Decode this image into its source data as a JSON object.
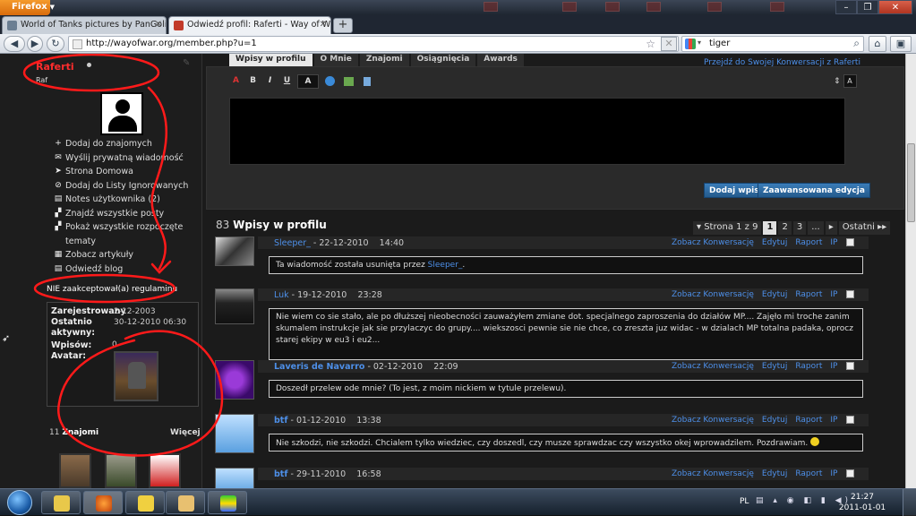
{
  "browser": {
    "menu_label": "Firefox",
    "tabs": [
      {
        "title": "World of Tanks pictures by PanGolia..."
      },
      {
        "title": "Odwiedź profil: Raferti - Way of War"
      }
    ],
    "new_tab": "+",
    "url": "http://wayofwar.org/member.php?u=1",
    "search_value": "tiger",
    "window_controls": {
      "minimize": "–",
      "maximize": "❐",
      "close": "✕"
    }
  },
  "profile": {
    "username": "Raferti",
    "user_title": "Raf",
    "actions": [
      {
        "icon": "plus-icon",
        "glyph": "+",
        "label": "Dodaj do znajomych"
      },
      {
        "icon": "mail-icon",
        "glyph": "✉",
        "label": "Wyślij prywatną wiadomość"
      },
      {
        "icon": "cursor-icon",
        "glyph": "➤",
        "label": "Strona Domowa"
      },
      {
        "icon": "block-icon",
        "glyph": "⊘",
        "label": "Dodaj do Listy Ignorowanych"
      },
      {
        "icon": "notes-icon",
        "glyph": "▤",
        "label": "Notes użytkownika (2)"
      },
      {
        "icon": "posts-icon",
        "glyph": "▞",
        "label": "Znajdź wszystkie posty"
      },
      {
        "icon": "threads-icon",
        "glyph": "▞",
        "label": "Pokaż wszystkie rozpoczęte tematy"
      },
      {
        "icon": "articles-icon",
        "glyph": "▦",
        "label": "Zobacz artykuły"
      },
      {
        "icon": "blog-icon",
        "glyph": "▤",
        "label": "Odwiedź blog"
      }
    ],
    "rules_status": "NIE zaakceptował(a) regulaminu",
    "info": {
      "joined_label": "Zarejestrowany",
      "joined_value": "2-12-2003",
      "last_active_label_1": "Ostatnio",
      "last_active_label_2": "aktywny:",
      "last_active_value": "30-12-2010 06:30",
      "posts_label": "Wpisów:",
      "posts_value": "0",
      "avatar_label": "Avatar:"
    },
    "friends_count": "11",
    "friends_label": "Znajomi",
    "friends_more": "Więcej"
  },
  "main": {
    "tabs": [
      "Wpisy w profilu",
      "O Mnie",
      "Znajomi",
      "Osiągnięcia",
      "Awards"
    ],
    "conversation_link": "Przejdź do Swojej Konwersacji z Raferti",
    "toolbar": [
      "A",
      "B",
      "I",
      "U",
      "A",
      "",
      "",
      ""
    ],
    "post_button": "Dodaj wpis",
    "advanced_button": "Zaawansowana edycja",
    "wall_count": "83",
    "wall_title": "Wpisy w profilu",
    "pager": {
      "label": "Strona 1 z 9",
      "pages": [
        "1",
        "2",
        "3"
      ],
      "ellipsis": "...",
      "next": "▸",
      "last": "Ostatni ▸▸"
    }
  },
  "posts": [
    {
      "user": "Sleeper_",
      "bold": false,
      "date": "22-12-2010",
      "time": "14:40",
      "text": "Ta wiadomość została usunięta przez",
      "text_link": "Sleeper_",
      "text_after": "."
    },
    {
      "user": "Luk",
      "bold": false,
      "date": "19-12-2010",
      "time": "23:28",
      "text": "Nie wiem co sie stało, ale po dłuższej nieobecności zauważyłem zmiane dot. specjalnego zaproszenia do działów MP.... Zajęło mi troche zanim skumalem instrukcje jak sie przylaczyc do grupy.... wiekszosci pewnie sie nie chce, co zreszta juz widac - w dzialach MP totalna padaka, oprocz starej ekipy w eu3 i eu2..."
    },
    {
      "user": "Laveris de Navarro",
      "bold": true,
      "date": "02-12-2010",
      "time": "22:09",
      "text": "Doszedł przelew ode mnie? (To jest, z moim nickiem w tytule przelewu)."
    },
    {
      "user": "btf",
      "bold": true,
      "date": "01-12-2010",
      "time": "13:38",
      "text": "Nie szkodzi, nie szkodzi. Chcialem tylko wiedziec, czy doszedl, czy musze sprawdzac czy wszystko okej wprowadzilem. Pozdrawiam."
    },
    {
      "user": "btf",
      "bold": true,
      "date": "29-11-2010",
      "time": "16:58",
      "text": ""
    }
  ],
  "post_options": [
    "Zobacz Konwersację",
    "Edytuj",
    "Raport",
    "IP"
  ],
  "taskbar": {
    "lang": "PL",
    "time": "21:27",
    "date": "2011-01-01"
  },
  "colors": {
    "accent_link": "#4d8fe8",
    "annotation_red": "#ff1a1a",
    "username_red": "#ff2d2d"
  }
}
